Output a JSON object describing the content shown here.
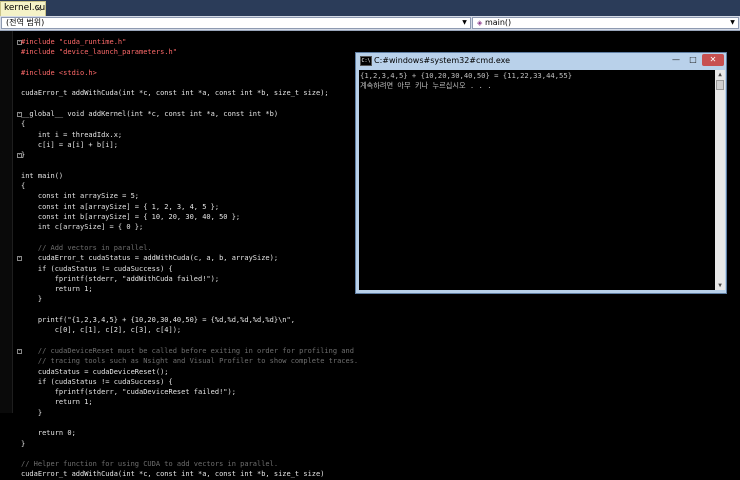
{
  "editor_tab": {
    "filename": "kernel.cu",
    "close": "×"
  },
  "navbar": {
    "scope": "(전역 범위)",
    "member": "main()",
    "arrow": "▼"
  },
  "code_lines": [
    {
      "t": "#include \"cuda_runtime.h\"",
      "c": "pp"
    },
    {
      "t": "#include \"device_launch_parameters.h\"",
      "c": "pp"
    },
    {
      "t": "",
      "c": ""
    },
    {
      "t": "#include <stdio.h>",
      "c": "pp"
    },
    {
      "t": "",
      "c": ""
    },
    {
      "t": "cudaError_t addWithCuda(int *c, const int *a, const int *b, size_t size);",
      "c": ""
    },
    {
      "t": "",
      "c": ""
    },
    {
      "t": "__global__ void addKernel(int *c, const int *a, const int *b)",
      "c": ""
    },
    {
      "t": "{",
      "c": ""
    },
    {
      "t": "    int i = threadIdx.x;",
      "c": ""
    },
    {
      "t": "    c[i] = a[i] + b[i];",
      "c": ""
    },
    {
      "t": "}",
      "c": ""
    },
    {
      "t": "",
      "c": ""
    },
    {
      "t": "int main()",
      "c": ""
    },
    {
      "t": "{",
      "c": ""
    },
    {
      "t": "    const int arraySize = 5;",
      "c": ""
    },
    {
      "t": "    const int a[arraySize] = { 1, 2, 3, 4, 5 };",
      "c": ""
    },
    {
      "t": "    const int b[arraySize] = { 10, 20, 30, 40, 50 };",
      "c": ""
    },
    {
      "t": "    int c[arraySize] = { 0 };",
      "c": ""
    },
    {
      "t": "",
      "c": ""
    },
    {
      "t": "    // Add vectors in parallel.",
      "c": "cm"
    },
    {
      "t": "    cudaError_t cudaStatus = addWithCuda(c, a, b, arraySize);",
      "c": ""
    },
    {
      "t": "    if (cudaStatus != cudaSuccess) {",
      "c": ""
    },
    {
      "t": "        fprintf(stderr, \"addWithCuda failed!\");",
      "c": ""
    },
    {
      "t": "        return 1;",
      "c": ""
    },
    {
      "t": "    }",
      "c": ""
    },
    {
      "t": "",
      "c": ""
    },
    {
      "t": "    printf(\"{1,2,3,4,5} + {10,20,30,40,50} = {%d,%d,%d,%d,%d}\\n\",",
      "c": ""
    },
    {
      "t": "        c[0], c[1], c[2], c[3], c[4]);",
      "c": ""
    },
    {
      "t": "",
      "c": ""
    },
    {
      "t": "    // cudaDeviceReset must be called before exiting in order for profiling and",
      "c": "cm"
    },
    {
      "t": "    // tracing tools such as Nsight and Visual Profiler to show complete traces.",
      "c": "cm"
    },
    {
      "t": "    cudaStatus = cudaDeviceReset();",
      "c": ""
    },
    {
      "t": "    if (cudaStatus != cudaSuccess) {",
      "c": ""
    },
    {
      "t": "        fprintf(stderr, \"cudaDeviceReset failed!\");",
      "c": ""
    },
    {
      "t": "        return 1;",
      "c": ""
    },
    {
      "t": "    }",
      "c": ""
    },
    {
      "t": "",
      "c": ""
    },
    {
      "t": "    return 0;",
      "c": ""
    },
    {
      "t": "}",
      "c": ""
    },
    {
      "t": "",
      "c": ""
    },
    {
      "t": "// Helper function for using CUDA to add vectors in parallel.",
      "c": "cm"
    },
    {
      "t": "cudaError_t addWithCuda(int *c, const int *a, const int *b, size_t size)",
      "c": ""
    }
  ],
  "cmd_window": {
    "title": "C:#windows#system32#cmd.exe",
    "minimize": "—",
    "maximize": "□",
    "close": "✕",
    "output_line1": "{1,2,3,4,5} + {10,20,30,40,50} = {11,22,33,44,55}",
    "output_line2": "계속하려면 아무 키나 누르십시오 . . ."
  },
  "colors": {
    "background": "#000000",
    "tab_active": "#f5f3c8",
    "cmd_titlebar": "#b9d1ea",
    "close_button": "#c75050"
  }
}
